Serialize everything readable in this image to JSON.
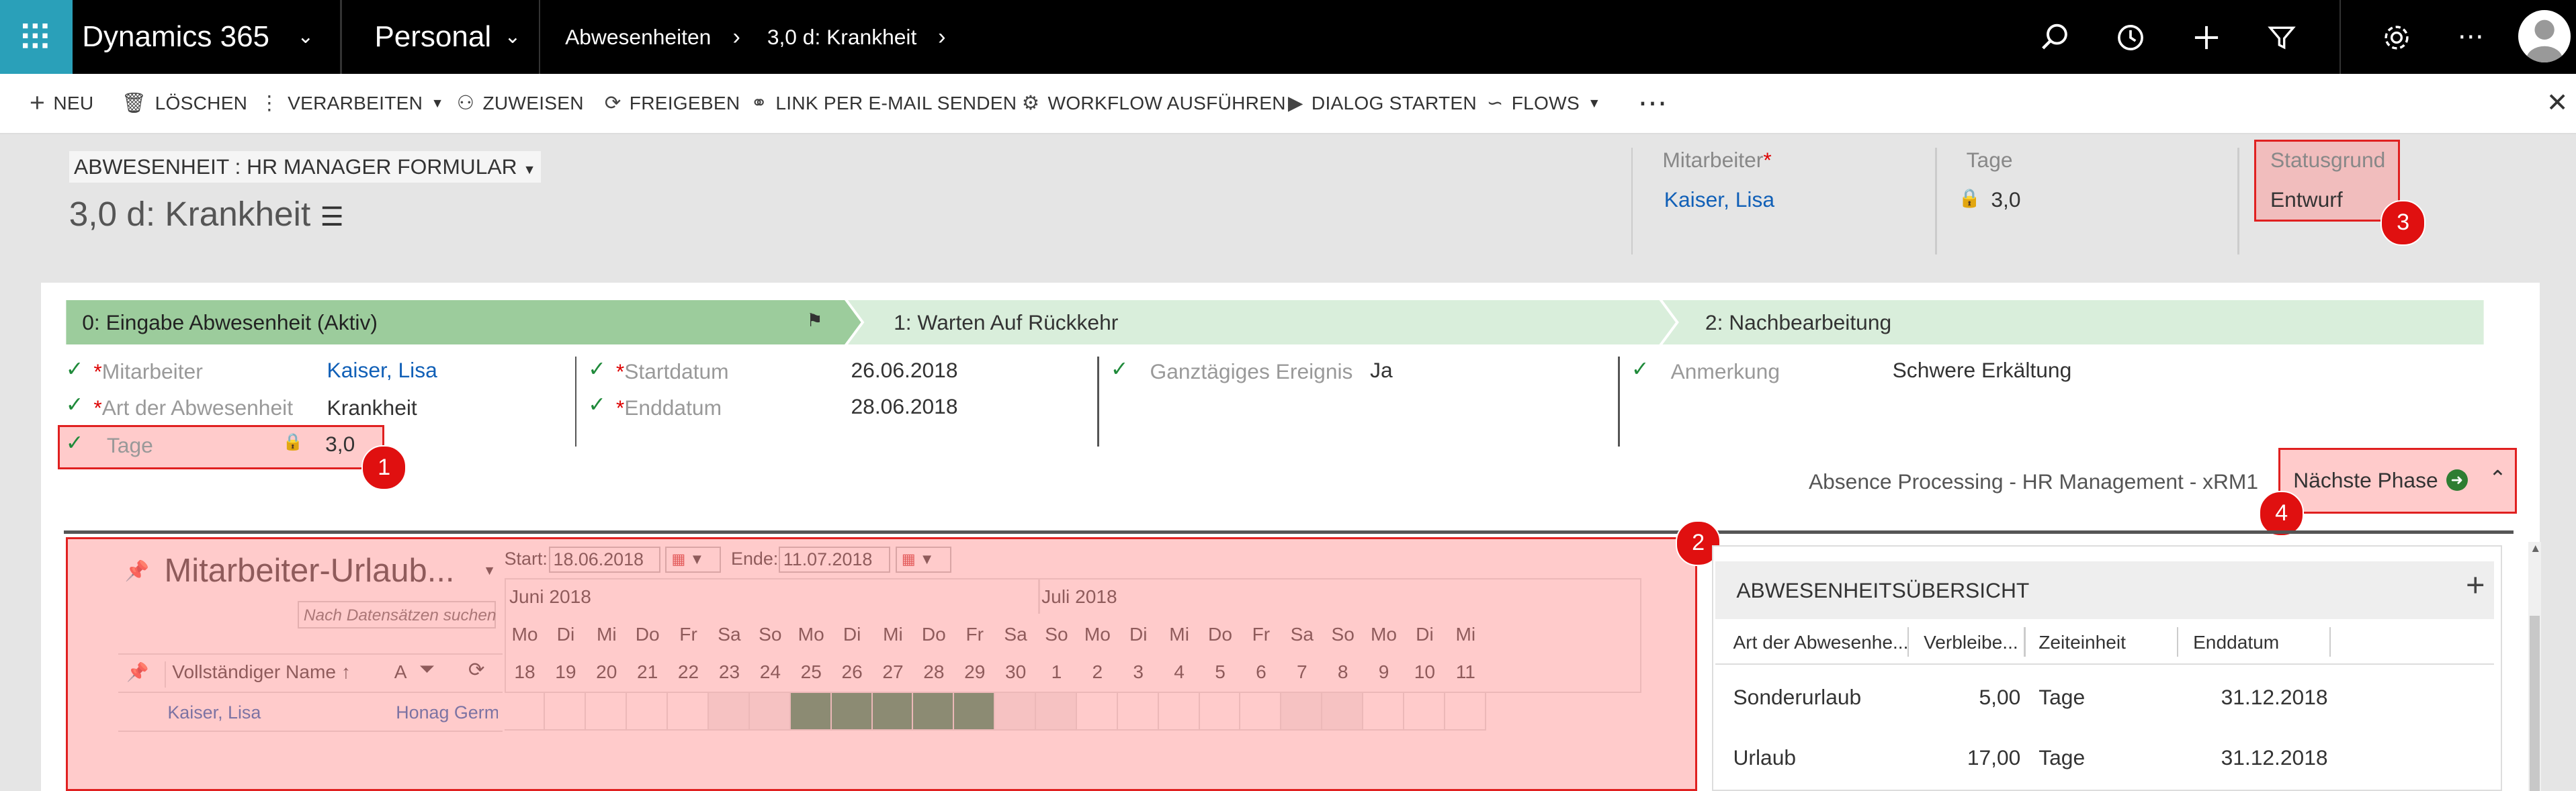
{
  "nav": {
    "app_title": "Dynamics 365",
    "area": "Personal",
    "crumb1": "Abwesenheiten",
    "crumb2": "3,0 d: Krankheit"
  },
  "commands": {
    "new": "NEU",
    "delete": "LÖSCHEN",
    "process": "VERARBEITEN",
    "assign": "ZUWEISEN",
    "share": "FREIGEBEN",
    "email_link": "LINK PER E-MAIL SENDEN",
    "workflow": "WORKFLOW AUSFÜHREN",
    "dialog": "DIALOG STARTEN",
    "flows": "FLOWS"
  },
  "header": {
    "form_selector": "ABWESENHEIT : HR MANAGER FORMULAR",
    "record_title": "3,0 d: Krankheit",
    "employee_label": "Mitarbeiter",
    "employee_value": "Kaiser, Lisa",
    "days_label": "Tage",
    "days_value": "3,0",
    "status_label": "Statusgrund",
    "status_value": "Entwurf"
  },
  "bpf": {
    "stages": [
      {
        "label": "0: Eingabe Abwesenheit (Aktiv)"
      },
      {
        "label": "1: Warten Auf Rückkehr"
      },
      {
        "label": "2: Nachbearbeitung"
      }
    ],
    "fields": {
      "employee_label": "Mitarbeiter",
      "employee_value": "Kaiser, Lisa",
      "type_label": "Art der Abwesenheit",
      "type_value": "Krankheit",
      "days_label": "Tage",
      "days_value": "3,0",
      "start_label": "Startdatum",
      "start_value": "26.06.2018",
      "end_label": "Enddatum",
      "end_value": "28.06.2018",
      "allday_label": "Ganztägiges Ereignis",
      "allday_value": "Ja",
      "note_label": "Anmerkung",
      "note_value": "Schwere Erkältung"
    },
    "process_name": "Absence Processing - HR Management - xRM1",
    "next_stage": "Nächste Phase"
  },
  "planner": {
    "title": "Mitarbeiter-Urlaub...",
    "search_placeholder": "Nach Datensätzen suchen",
    "start_label": "Start:",
    "start_value": "18.06.2018",
    "end_label": "Ende:",
    "end_value": "11.07.2018",
    "month1": "Juni 2018",
    "month2": "Juli 2018",
    "weekdays": [
      "Mo",
      "Di",
      "Mi",
      "Do",
      "Fr",
      "Sa",
      "So",
      "Mo",
      "Di",
      "Mi",
      "Do",
      "Fr",
      "Sa",
      "So",
      "Mo",
      "Di",
      "Mi",
      "Do",
      "Fr",
      "Sa",
      "So",
      "Mo",
      "Di",
      "Mi"
    ],
    "days": [
      "18",
      "19",
      "20",
      "21",
      "22",
      "23",
      "24",
      "25",
      "26",
      "27",
      "28",
      "29",
      "30",
      "1",
      "2",
      "3",
      "4",
      "5",
      "6",
      "7",
      "8",
      "9",
      "10",
      "11"
    ],
    "col_name": "Vollständiger Name",
    "col_a": "A",
    "row_name": "Kaiser, Lisa",
    "row_company": "Honag Germa"
  },
  "summary": {
    "title": "ABWESENHEITSÜBERSICHT",
    "columns": [
      "Art der Abwesenhe...",
      "Verbleibe...",
      "Zeiteinheit",
      "Enddatum"
    ],
    "rows": [
      [
        "Sonderurlaub",
        "5,00",
        "Tage",
        "31.12.2018"
      ],
      [
        "Urlaub",
        "17,00",
        "Tage",
        "31.12.2018"
      ]
    ]
  },
  "badges": [
    "1",
    "2",
    "3",
    "4"
  ],
  "colors": {
    "nav_bg": "#000000",
    "waffle_bg": "#2aa0b9",
    "stage_active": "#9ccc9c",
    "stage_inactive": "#d9eedb",
    "absence_bar": "#2e8b5f",
    "highlight": "#e02020"
  }
}
